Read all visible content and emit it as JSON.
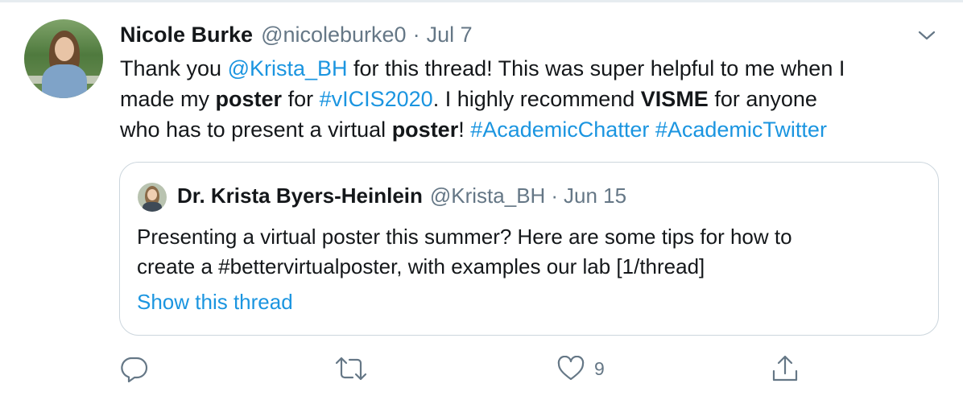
{
  "tweet": {
    "author_name": "Nicole Burke",
    "author_handle": "@nicoleburke0",
    "separator": "·",
    "date": "Jul 7",
    "text_lines": [
      [
        {
          "t": "Thank you ",
          "s": "plain"
        },
        {
          "t": "@Krista_BH",
          "s": "link"
        },
        {
          "t": " for this thread! This was super helpful to me when I",
          "s": "plain"
        }
      ],
      [
        {
          "t": "made my ",
          "s": "plain"
        },
        {
          "t": "poster",
          "s": "bold"
        },
        {
          "t": " for ",
          "s": "plain"
        },
        {
          "t": "#vICIS2020",
          "s": "link"
        },
        {
          "t": ". I highly recommend ",
          "s": "plain"
        },
        {
          "t": "VISME",
          "s": "bold"
        },
        {
          "t": " for anyone",
          "s": "plain"
        }
      ],
      [
        {
          "t": "who has to present a virtual ",
          "s": "plain"
        },
        {
          "t": "poster",
          "s": "bold"
        },
        {
          "t": "! ",
          "s": "plain"
        },
        {
          "t": "#AcademicChatter",
          "s": "link"
        },
        {
          "t": " ",
          "s": "plain"
        },
        {
          "t": "#AcademicTwitter",
          "s": "link"
        }
      ]
    ]
  },
  "quoted": {
    "author_name": "Dr. Krista Byers-Heinlein",
    "author_handle": "@Krista_BH",
    "separator": "·",
    "date": "Jun 15",
    "text_lines": [
      "Presenting a virtual poster this summer? Here are some tips for how to",
      "create a #bettervirtualposter, with examples our lab [1/thread]"
    ],
    "show_thread_label": "Show this thread"
  },
  "actions": {
    "reply_icon": "reply-icon",
    "retweet_icon": "retweet-icon",
    "like_icon": "heart-icon",
    "like_count": "9",
    "share_icon": "share-icon"
  },
  "colors": {
    "link": "#1b95e0",
    "secondary_text": "#657786",
    "border": "#ccd6dd"
  }
}
